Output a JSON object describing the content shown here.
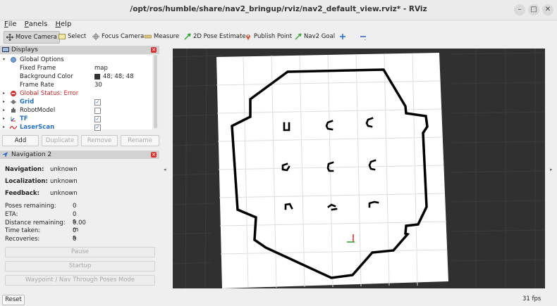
{
  "window": {
    "title": "/opt/ros/humble/share/nav2_bringup/rviz/nav2_default_view.rviz* - RViz",
    "buttons": {
      "minimize": "–",
      "maximize": "□",
      "close": "✕"
    }
  },
  "menu": [
    {
      "label": "File",
      "mnemonic": "F",
      "rest": "ile"
    },
    {
      "label": "Panels",
      "mnemonic": "P",
      "rest": "anels"
    },
    {
      "label": "Help",
      "mnemonic": "H",
      "rest": "elp"
    }
  ],
  "toolbar": {
    "move_camera": "Move Camera",
    "select": "Select",
    "focus_camera": "Focus Camera",
    "measure": "Measure",
    "pose_estimate": "2D Pose Estimate",
    "publish_point": "Publish Point",
    "nav2_goal": "Nav2 Goal"
  },
  "displays": {
    "header": "Displays",
    "global_options": "Global Options",
    "fixed_frame_label": "Fixed Frame",
    "fixed_frame_value": "map",
    "background_color_label": "Background Color",
    "background_color_value": "48; 48; 48",
    "background_color_hex": "#303030",
    "frame_rate_label": "Frame Rate",
    "frame_rate_value": "30",
    "global_status": "Global Status: Error",
    "grid": "Grid",
    "grid_checked": true,
    "robot_model": "RobotModel",
    "robot_model_checked": false,
    "tf": "TF",
    "tf_checked": true,
    "laser_scan": "LaserScan",
    "laser_scan_checked": true,
    "buttons": {
      "add": "Add",
      "duplicate": "Duplicate",
      "remove": "Remove",
      "rename": "Rename"
    }
  },
  "navigation": {
    "header": "Navigation 2",
    "navigation_label": "Navigation:",
    "navigation_value": "unknown",
    "localization_label": "Localization:",
    "localization_value": "unknown",
    "feedback_label": "Feedback:",
    "feedback_value": "unknown",
    "poses_remaining_label": "Poses remaining:",
    "poses_remaining_value": "0",
    "eta_label": "ETA:",
    "eta_value": "0 s",
    "distance_remaining_label": "Distance remaining:",
    "distance_remaining_value": "0.00 m",
    "time_taken_label": "Time taken:",
    "time_taken_value": "0 s",
    "recoveries_label": "Recoveries:",
    "recoveries_value": "0",
    "pause_button": "Pause",
    "startup_button": "Startup",
    "waypoint_button": "Waypoint / Nav Through Poses Mode"
  },
  "status": {
    "reset": "Reset",
    "fps": "31 fps"
  },
  "colors": {
    "error": "#cc2222",
    "highlight": "#1f6fc6",
    "viewport_bg": "#303030",
    "map_free": "#ffffff",
    "map_wall": "#000000"
  }
}
